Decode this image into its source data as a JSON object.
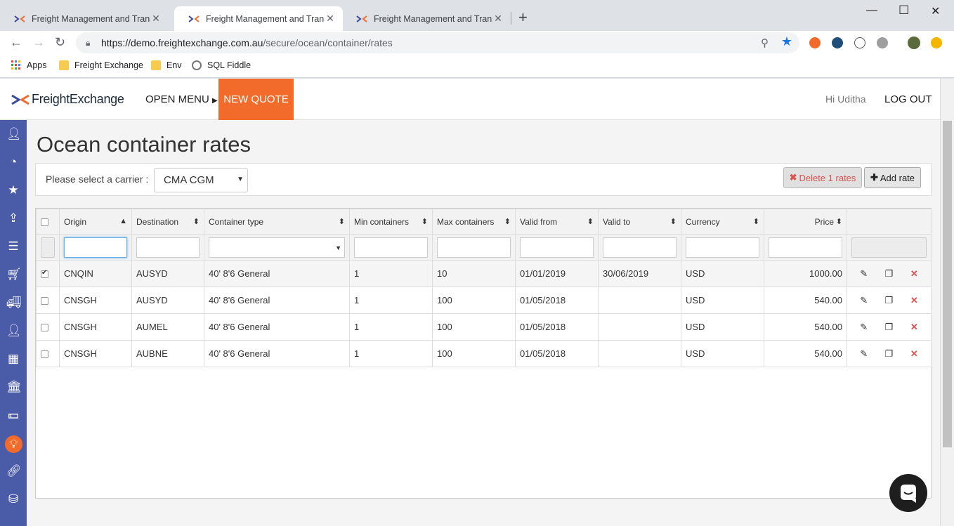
{
  "browser": {
    "tabs": [
      {
        "title": "Freight Management and Transp",
        "active": false
      },
      {
        "title": "Freight Management and Transp",
        "active": true
      },
      {
        "title": "Freight Management and Transp",
        "active": false
      }
    ],
    "url_host": "https://demo.freightexchange.com.au",
    "url_path": "/secure/ocean/container/rates",
    "bookmarks": [
      "Apps",
      "Freight Exchange",
      "Env",
      "SQL Fiddle"
    ]
  },
  "header": {
    "logo_text": "FreightExchange",
    "open_menu": "OPEN MENU",
    "new_quote": "NEW QUOTE",
    "greeting": "Hi Uditha",
    "logout": "LOG OUT"
  },
  "sidebar_icons": [
    "user-tie-icon",
    "dashboard-icon",
    "star-icon",
    "upload-icon",
    "list-icon",
    "cart-icon",
    "truck-icon",
    "user-icon",
    "building-icon",
    "bank-icon",
    "money-icon",
    "lightbulb-icon",
    "link-icon",
    "database-icon"
  ],
  "main": {
    "title": "Ocean container rates",
    "carrier_label": "Please select a carrier :",
    "carrier_value": "CMA CGM",
    "delete_label": "Delete 1 rates",
    "add_label": "Add rate"
  },
  "grid": {
    "columns": [
      "Origin",
      "Destination",
      "Container type",
      "Min containers",
      "Max containers",
      "Valid from",
      "Valid to",
      "Currency",
      "Price"
    ],
    "rows": [
      {
        "checked": true,
        "origin": "CNQIN",
        "destination": "AUSYD",
        "container_type": "40' 8'6 General",
        "min": "1",
        "max": "10",
        "valid_from": "01/01/2019",
        "valid_to": "30/06/2019",
        "currency": "USD",
        "price": "1000.00"
      },
      {
        "checked": false,
        "origin": "CNSGH",
        "destination": "AUSYD",
        "container_type": "40' 8'6 General",
        "min": "1",
        "max": "100",
        "valid_from": "01/05/2018",
        "valid_to": "",
        "currency": "USD",
        "price": "540.00"
      },
      {
        "checked": false,
        "origin": "CNSGH",
        "destination": "AUMEL",
        "container_type": "40' 8'6 General",
        "min": "1",
        "max": "100",
        "valid_from": "01/05/2018",
        "valid_to": "",
        "currency": "USD",
        "price": "540.00"
      },
      {
        "checked": false,
        "origin": "CNSGH",
        "destination": "AUBNE",
        "container_type": "40' 8'6 General",
        "min": "1",
        "max": "100",
        "valid_from": "01/05/2018",
        "valid_to": "",
        "currency": "USD",
        "price": "540.00"
      }
    ]
  },
  "colors": {
    "brand_orange": "#f26b2a",
    "sidebar_blue": "#4a5ba8",
    "danger_red": "#d9534f"
  }
}
